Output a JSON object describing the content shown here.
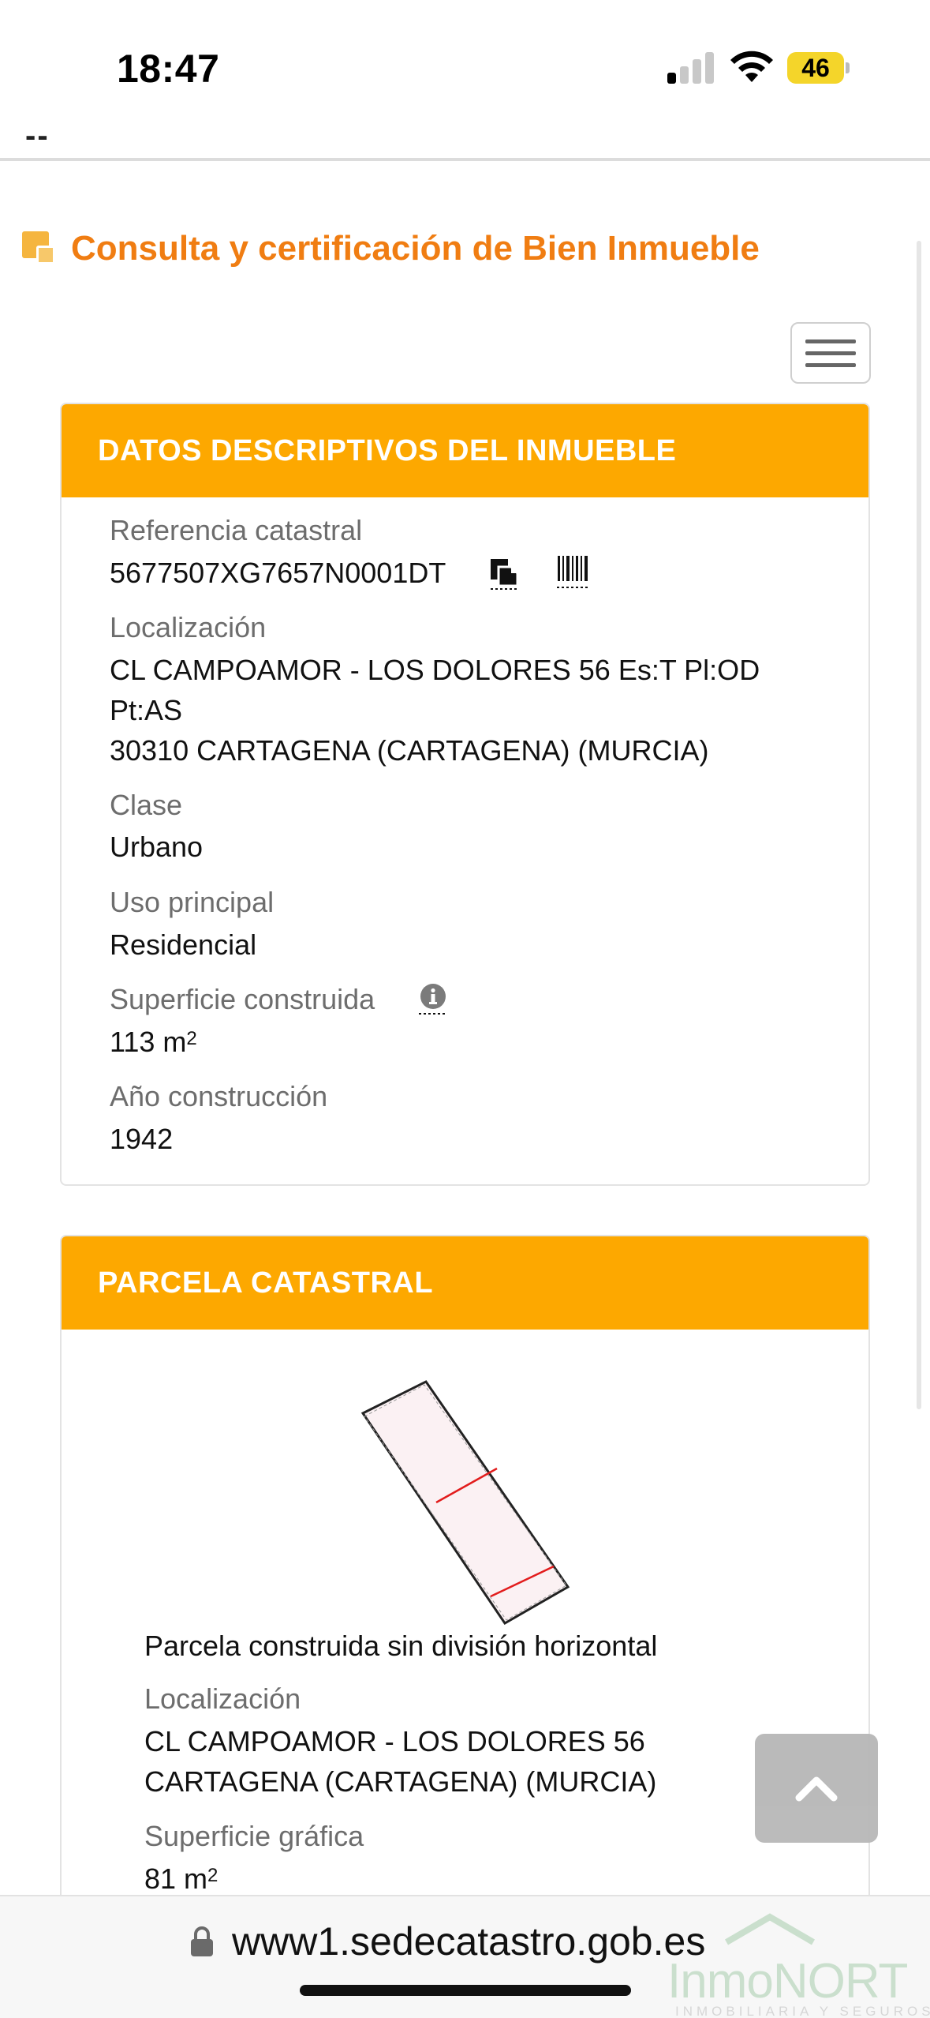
{
  "status_bar": {
    "time": "18:47",
    "battery": "46"
  },
  "nav": {
    "dots": "--"
  },
  "page": {
    "title": "Consulta y certificación de Bien Inmueble"
  },
  "inmueble": {
    "header": "DATOS DESCRIPTIVOS DEL INMUEBLE",
    "referencia_label": "Referencia catastral",
    "referencia_value": "5677507XG7657N0001DT",
    "localizacion_label": "Localización",
    "localizacion_line1": "CL CAMPOAMOR - LOS DOLORES 56 Es:T Pl:OD",
    "localizacion_line2": "Pt:AS",
    "localizacion_line3": "30310 CARTAGENA (CARTAGENA) (MURCIA)",
    "clase_label": "Clase",
    "clase_value": "Urbano",
    "uso_label": "Uso principal",
    "uso_value": "Residencial",
    "superficie_label": "Superficie construida",
    "superficie_value": "113 m",
    "superficie_exp": "2",
    "anio_label": "Año construcción",
    "anio_value": "1942"
  },
  "parcela": {
    "header": "PARCELA CATASTRAL",
    "descripcion": "Parcela construida sin división horizontal",
    "localizacion_label": "Localización",
    "localizacion_line1": "CL CAMPOAMOR - LOS DOLORES 56",
    "localizacion_line2": "CARTAGENA (CARTAGENA) (MURCIA)",
    "superficie_label": "Superficie gráfica",
    "superficie_value": "81 m",
    "superficie_exp": "2"
  },
  "browser": {
    "url": "www1.sedecatastro.gob.es"
  },
  "watermark": {
    "brand": "InmoNORT",
    "tagline": "INMOBILIARIA Y SEGUROS"
  },
  "colors": {
    "accent_orange": "#f07d12",
    "panel_header": "#fda800"
  },
  "icons": {
    "copy": "copy-icon",
    "barcode": "barcode-icon",
    "info": "info-icon",
    "menu": "hamburger-icon",
    "scroll_top": "chevron-up-icon",
    "lock": "lock-icon"
  }
}
